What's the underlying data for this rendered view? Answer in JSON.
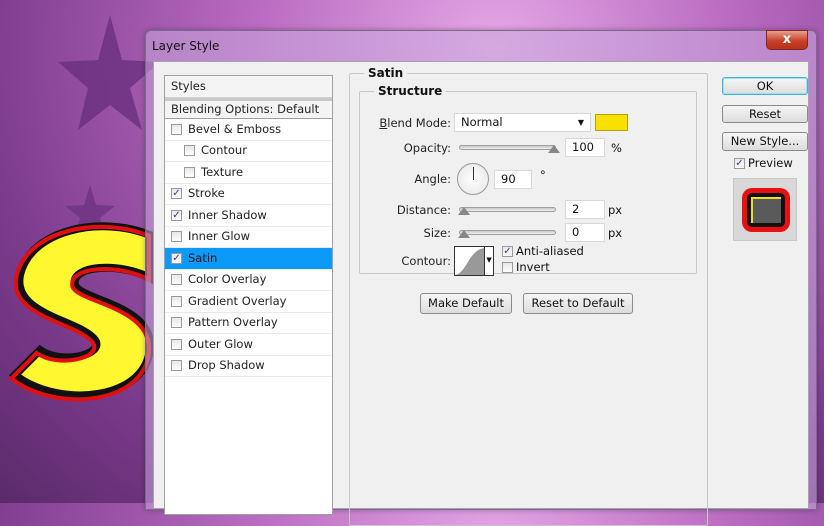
{
  "window": {
    "title": "Layer Style",
    "close_label": "x"
  },
  "styles_panel": {
    "header": "Styles",
    "blending": "Blending Options: Default",
    "items": [
      {
        "label": "Bevel & Emboss",
        "checked": false,
        "sub": false
      },
      {
        "label": "Contour",
        "checked": false,
        "sub": true
      },
      {
        "label": "Texture",
        "checked": false,
        "sub": true
      },
      {
        "label": "Stroke",
        "checked": true,
        "sub": false
      },
      {
        "label": "Inner Shadow",
        "checked": true,
        "sub": false
      },
      {
        "label": "Inner Glow",
        "checked": false,
        "sub": false
      },
      {
        "label": "Satin",
        "checked": true,
        "sub": false,
        "selected": true
      },
      {
        "label": "Color Overlay",
        "checked": false,
        "sub": false
      },
      {
        "label": "Gradient Overlay",
        "checked": false,
        "sub": false
      },
      {
        "label": "Pattern Overlay",
        "checked": false,
        "sub": false
      },
      {
        "label": "Outer Glow",
        "checked": false,
        "sub": false
      },
      {
        "label": "Drop Shadow",
        "checked": false,
        "sub": false
      }
    ]
  },
  "satin": {
    "title": "Satin",
    "structure": "Structure",
    "blend_mode_label": "Blend Mode:",
    "blend_mode": "Normal",
    "color": "#f8e000",
    "opacity_label": "Opacity:",
    "opacity": "100",
    "opacity_unit": "%",
    "angle_label": "Angle:",
    "angle": "90",
    "angle_unit": "°",
    "distance_label": "Distance:",
    "distance": "2",
    "distance_unit": "px",
    "size_label": "Size:",
    "size": "0",
    "size_unit": "px",
    "contour_label": "Contour:",
    "anti_aliased": "Anti-aliased",
    "anti_aliased_checked": true,
    "invert": "Invert",
    "invert_checked": false,
    "make_default": "Make Default",
    "reset_default": "Reset to Default"
  },
  "buttons": {
    "ok": "OK",
    "reset": "Reset",
    "new_style": "New Style...",
    "preview": "Preview",
    "preview_checked": true
  },
  "check_mark": "✓"
}
